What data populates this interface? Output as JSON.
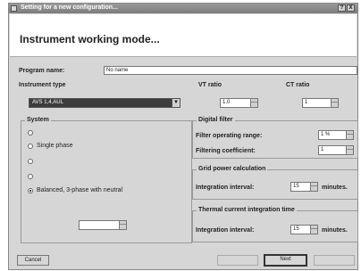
{
  "window": {
    "title": "Setting for a new configuration...",
    "help_label": "?",
    "close_label": "X"
  },
  "header": {
    "title": "Instrument working mode..."
  },
  "program": {
    "label": "Program name:",
    "value": "No name"
  },
  "instrument_type": {
    "label": "Instrument type",
    "value": "AVS 1,4,AUL"
  },
  "vt_ratio": {
    "label": "VT ratio",
    "value": "1.0"
  },
  "ct_ratio": {
    "label": "CT ratio",
    "value": "1"
  },
  "system": {
    "label": "System",
    "options": [
      {
        "label": "",
        "selected": false
      },
      {
        "label": "Single phase",
        "selected": false
      },
      {
        "label": "",
        "selected": false
      },
      {
        "label": "",
        "selected": false
      },
      {
        "label": "Balanced, 3-phase with neutral",
        "selected": true
      }
    ],
    "spin_value": ""
  },
  "digital_filter": {
    "label": "Digital filter",
    "range_label": "Filter operating range:",
    "range_value": "1 %",
    "coef_label": "Filtering coefficient:",
    "coef_value": "1"
  },
  "grid_power": {
    "label": "Grid power calculation",
    "interval_label": "Integration interval:",
    "interval_value": "15",
    "unit": "minutes."
  },
  "thermal": {
    "label": "Thermal current integration time",
    "interval_label": "Integration interval:",
    "interval_value": "15",
    "unit": "minutes."
  },
  "buttons": {
    "cancel": "Cancel",
    "back": "",
    "next": "Next",
    "finish": ""
  }
}
